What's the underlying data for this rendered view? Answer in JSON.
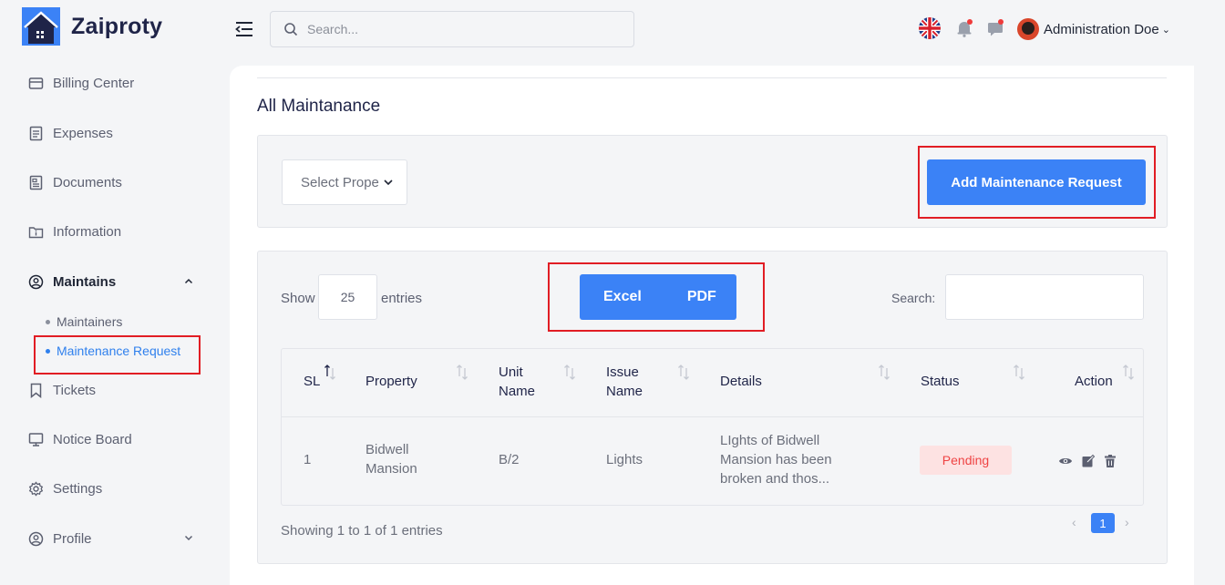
{
  "brand": {
    "name": "Zaiproty"
  },
  "sidebar": {
    "items": [
      {
        "label": "Billing Center",
        "icon": "billing-icon"
      },
      {
        "label": "Expenses",
        "icon": "receipt-icon"
      },
      {
        "label": "Documents",
        "icon": "document-icon"
      },
      {
        "label": "Information",
        "icon": "info-icon"
      },
      {
        "label": "Maintains",
        "icon": "user-circle-icon"
      },
      {
        "label": "Tickets",
        "icon": "bookmark-icon"
      },
      {
        "label": "Notice Board",
        "icon": "monitor-icon"
      },
      {
        "label": "Settings",
        "icon": "gear-icon"
      },
      {
        "label": "Profile",
        "icon": "user-circle-icon"
      }
    ],
    "submenu": [
      {
        "label": "Maintainers"
      },
      {
        "label": "Maintenance Request"
      }
    ]
  },
  "header": {
    "search_placeholder": "Search...",
    "user_name": "Administration Doe"
  },
  "page": {
    "title": "All Maintanance"
  },
  "filter": {
    "select_property": "Select Property",
    "add_button": "Add Maintenance Request"
  },
  "table_controls": {
    "show_label": "Show",
    "entries_value": "25",
    "entries_label": "entries",
    "export_excel": "Excel",
    "export_pdf": "PDF",
    "search_label": "Search:"
  },
  "table": {
    "headers": [
      "SL",
      "Property",
      "Unit Name",
      "Issue Name",
      "Details",
      "Status",
      "Action"
    ],
    "rows": [
      {
        "sl": "1",
        "property": "Bidwell Mansion",
        "unit": "B/2",
        "issue": "Lights",
        "details": "LIghts of Bidwell Mansion has been broken and thos...",
        "status": "Pending"
      }
    ]
  },
  "footer": {
    "showing": "Showing 1 to 1 of 1 entries",
    "current_page": "1"
  },
  "colors": {
    "primary": "#3b82f6",
    "active_link": "#2f80ed",
    "highlight_box": "#e11d24",
    "pending_bg": "#fde2e2",
    "pending_text": "#ef4444"
  }
}
